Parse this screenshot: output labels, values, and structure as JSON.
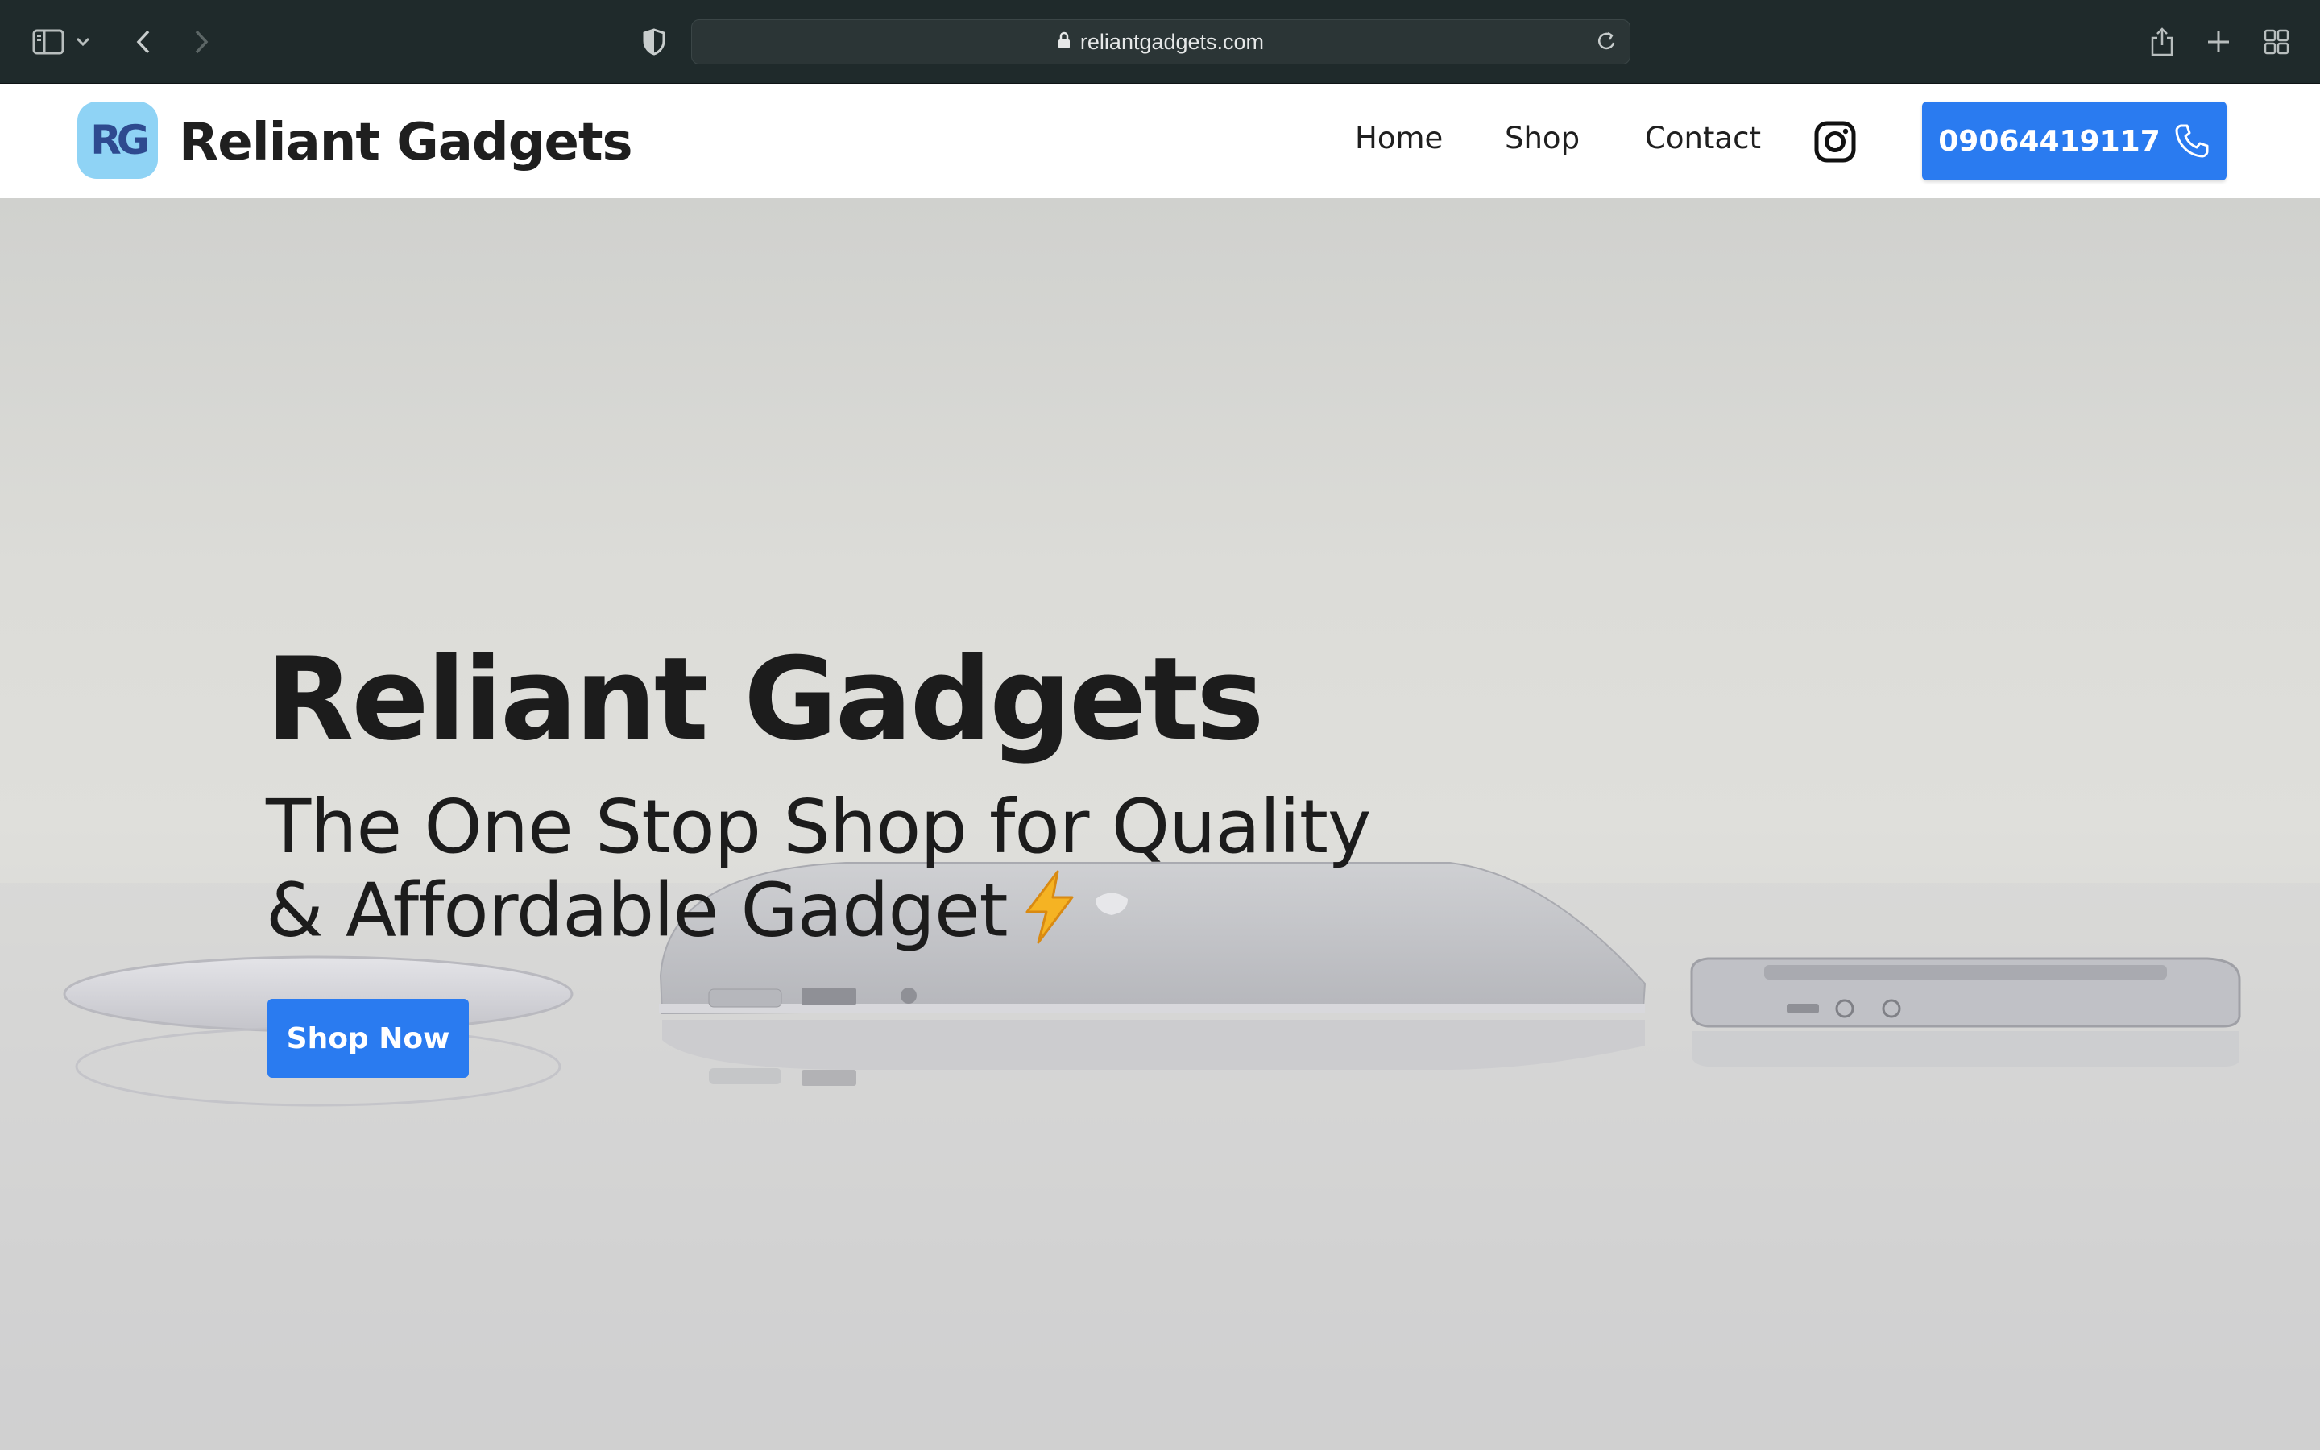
{
  "browser": {
    "url": "reliantgadgets.com"
  },
  "header": {
    "logo_text": "RG",
    "brand": "Reliant Gadgets",
    "nav": [
      "Home",
      "Shop",
      "Contact"
    ],
    "phone": "09064419117"
  },
  "hero": {
    "title": "Reliant Gadgets",
    "subtitle_line1": "The One Stop Shop for Quality",
    "subtitle_line2": "& Affordable Gadget",
    "cta": "Shop Now"
  },
  "colors": {
    "accent": "#2a7bf0",
    "logo_bg": "#8fd3f5",
    "chrome": "#1f2a2b"
  }
}
